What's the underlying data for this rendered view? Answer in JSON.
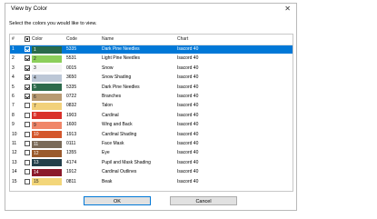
{
  "dialog": {
    "title": "View by Color",
    "close_glyph": "✕",
    "instruction": "Select the colors you would like to view."
  },
  "table": {
    "headers": {
      "num": "#",
      "color": "Color",
      "code": "Code",
      "name": "Name",
      "chart": "Chart"
    },
    "header_checkbox_state": "partial",
    "sort_glyph": "^",
    "rows": [
      {
        "num": "1",
        "checked": true,
        "swatch": "#2a6b4a",
        "code": "5335",
        "name": "Dark Pine Needles",
        "chart": "Isacord 40",
        "selected": true
      },
      {
        "num": "2",
        "checked": true,
        "swatch": "#8ccf5a",
        "code": "5531",
        "name": "Light Pine Needles",
        "chart": "Isacord 40"
      },
      {
        "num": "3",
        "checked": true,
        "swatch": "#f4f4f4",
        "code": "0015",
        "name": "Snow",
        "chart": "Isacord 40"
      },
      {
        "num": "4",
        "checked": true,
        "swatch": "#bcc7d6",
        "code": "3650",
        "name": "Snow Shading",
        "chart": "Isacord 40"
      },
      {
        "num": "5",
        "checked": true,
        "swatch": "#2d6b4b",
        "code": "5335",
        "name": "Dark Pine Needles",
        "chart": "Isacord 40"
      },
      {
        "num": "6",
        "checked": true,
        "swatch": "#b89a72",
        "code": "0722",
        "name": "Branches",
        "chart": "Isacord 40"
      },
      {
        "num": "7",
        "checked": false,
        "swatch": "#f2d17a",
        "code": "0832",
        "name": "Talon",
        "chart": "Isacord 40"
      },
      {
        "num": "8",
        "checked": false,
        "swatch": "#d9312b",
        "code": "1903",
        "name": "Cardinal",
        "chart": "Isacord 40"
      },
      {
        "num": "9",
        "checked": false,
        "swatch": "#f0876a",
        "code": "1600",
        "name": "Wing and Back",
        "chart": "Isacord 40"
      },
      {
        "num": "10",
        "checked": false,
        "swatch": "#d4572c",
        "code": "1913",
        "name": "Cardinal Shading",
        "chart": "Isacord 40"
      },
      {
        "num": "11",
        "checked": false,
        "swatch": "#7a6a58",
        "code": "0111",
        "name": "Face Mask",
        "chart": "Isacord 40"
      },
      {
        "num": "12",
        "checked": false,
        "swatch": "#9a5a2c",
        "code": "1355",
        "name": "Eye",
        "chart": "Isacord 40"
      },
      {
        "num": "13",
        "checked": false,
        "swatch": "#233f4a",
        "code": "4174",
        "name": "Pupil and Mask Shading",
        "chart": "Isacord 40"
      },
      {
        "num": "14",
        "checked": false,
        "swatch": "#8b1a2b",
        "code": "1912",
        "name": "Cardinal Outlines",
        "chart": "Isacord 40"
      },
      {
        "num": "15",
        "checked": false,
        "swatch": "#f3d67a",
        "code": "0811",
        "name": "Beak",
        "chart": "Isacord 40"
      }
    ]
  },
  "buttons": {
    "ok": "OK",
    "cancel": "Cancel"
  }
}
